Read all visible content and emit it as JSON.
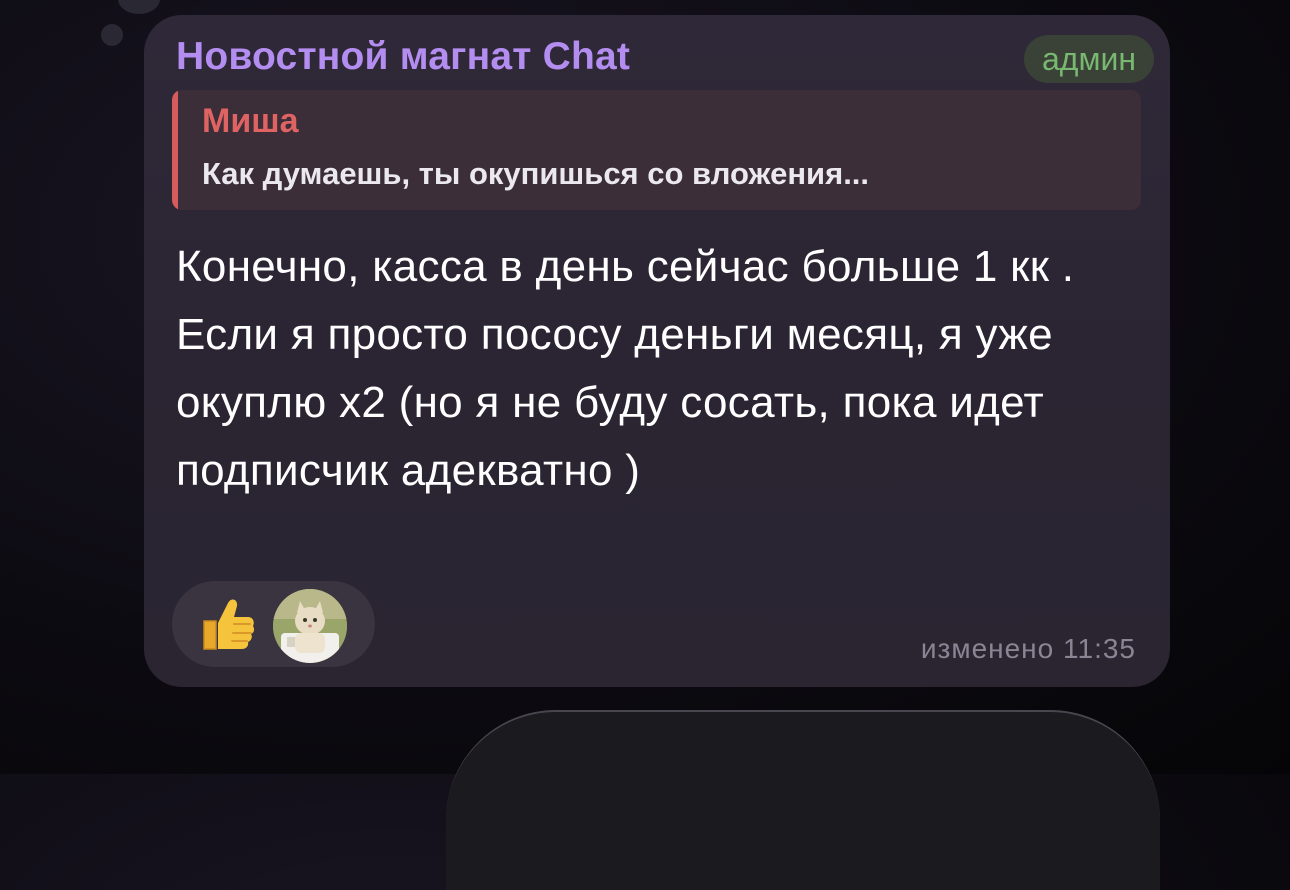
{
  "message": {
    "sender_name": "Новостной магнат Chat",
    "role_badge": "админ",
    "reply": {
      "author": "Миша",
      "text": "Как думаешь, ты окупишься со вложения..."
    },
    "text": "Конечно, касса в день сейчас больше 1 кк . Если я просто пососу деньги месяц, я уже окуплю х2 (но я не буду сосать, пока идет подписчик адекватно )",
    "reactions": [
      {
        "icon": "thumbs-up-icon"
      },
      {
        "icon": "user-avatar-cat"
      }
    ],
    "edited_label": "изменено",
    "time": "11:35"
  },
  "colors": {
    "sender": "#b38df0",
    "badge_text": "#78b870",
    "reply_accent": "#d45c5c",
    "bubble": "#2b2533"
  }
}
